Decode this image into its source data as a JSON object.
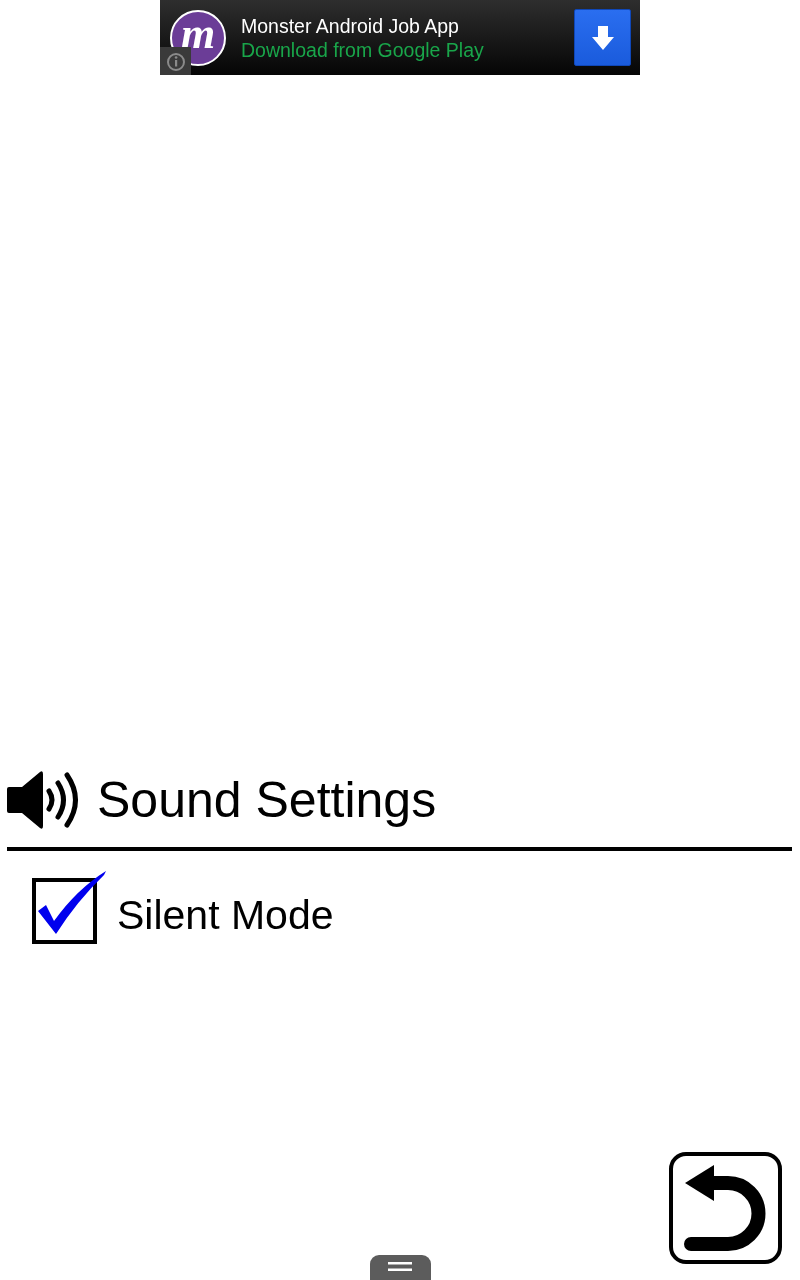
{
  "ad_banner": {
    "logo_letter": "m",
    "title": "Monster Android Job App",
    "subtitle": "Download from Google Play"
  },
  "settings": {
    "title": "Sound Settings",
    "options": [
      {
        "label": "Silent Mode",
        "checked": true
      }
    ]
  }
}
